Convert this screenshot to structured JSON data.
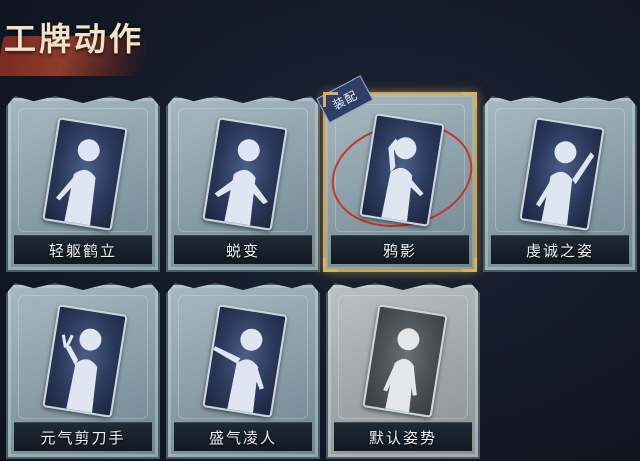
{
  "header": {
    "title": "工牌动作"
  },
  "badges": {
    "equipped": "装配"
  },
  "cards": [
    {
      "label": "轻躯鹤立",
      "icon": "pose-silhouette-icon",
      "equipped": false,
      "variant": "normal"
    },
    {
      "label": "蜕变",
      "icon": "pose-silhouette-icon",
      "equipped": false,
      "variant": "normal"
    },
    {
      "label": "鸦影",
      "icon": "pose-silhouette-icon",
      "equipped": true,
      "variant": "normal"
    },
    {
      "label": "虔诚之姿",
      "icon": "pose-silhouette-icon",
      "equipped": false,
      "variant": "normal"
    },
    {
      "label": "元气剪刀手",
      "icon": "pose-silhouette-icon",
      "equipped": false,
      "variant": "normal"
    },
    {
      "label": "盛气凌人",
      "icon": "pose-silhouette-icon",
      "equipped": false,
      "variant": "normal"
    },
    {
      "label": "默认姿势",
      "icon": "pose-silhouette-icon",
      "equipped": false,
      "variant": "default"
    }
  ],
  "colors": {
    "background": "#121826",
    "accent_gold": "#c9a356",
    "highlight_red": "#c8352a",
    "title_brush": "#8d3b2c"
  }
}
